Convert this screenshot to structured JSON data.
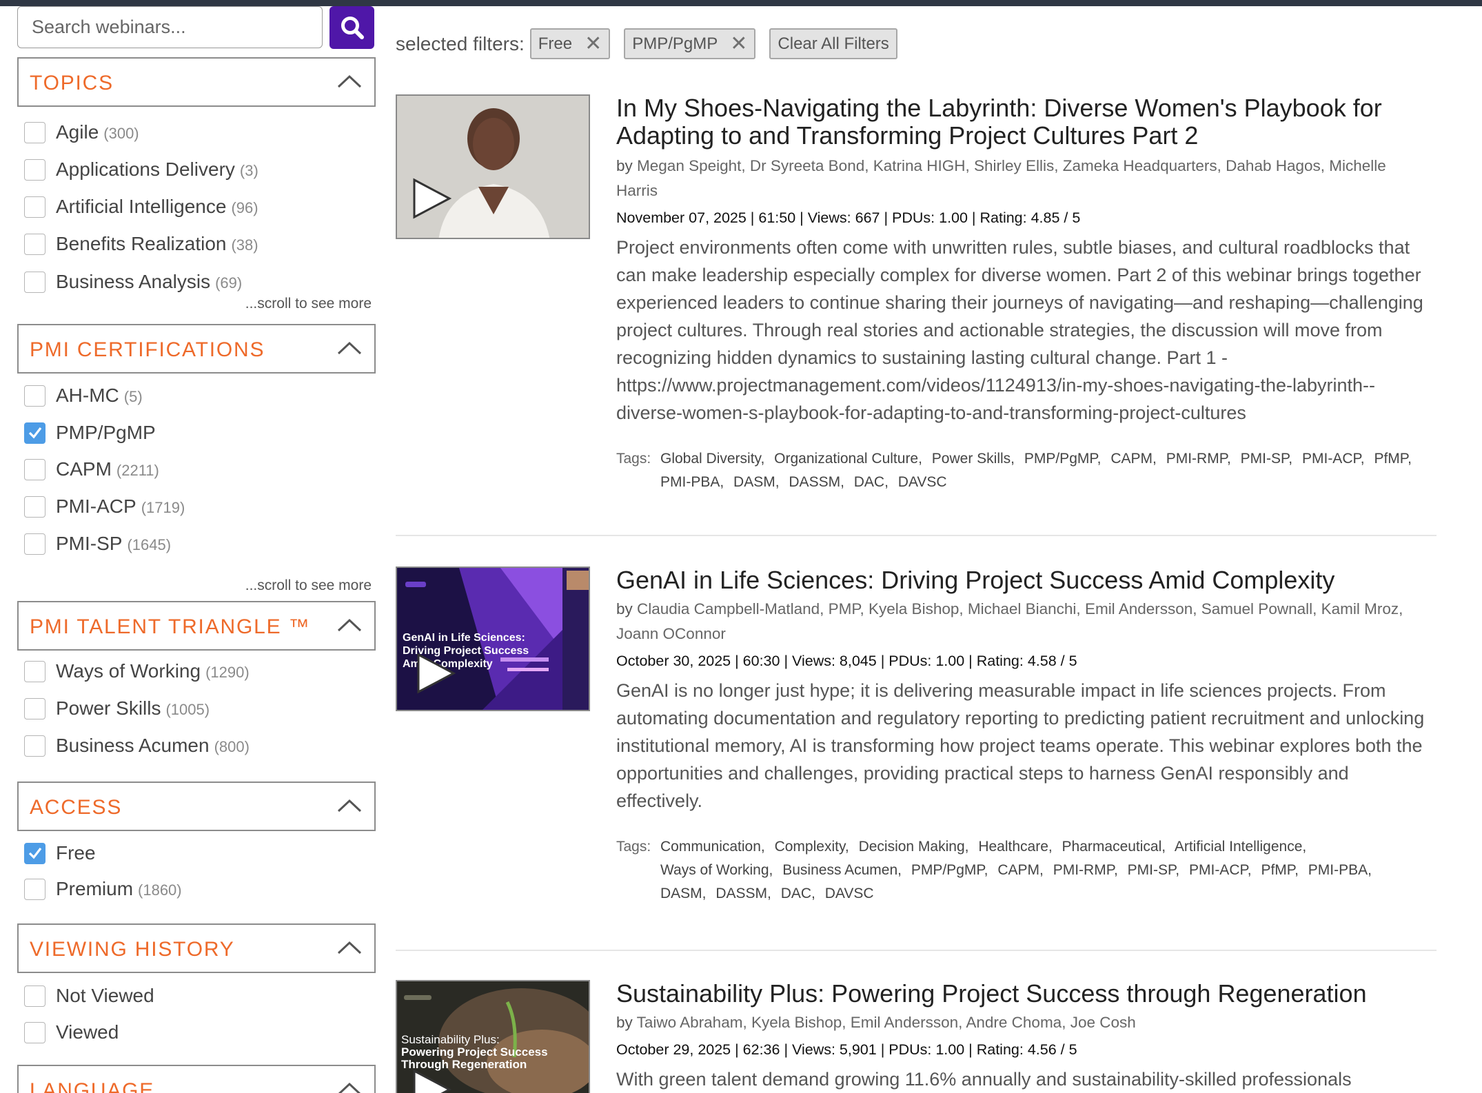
{
  "search": {
    "placeholder": "Search webinars..."
  },
  "facets": {
    "topics": {
      "title": "TOPICS",
      "items": [
        {
          "label": "Agile",
          "count": "(300)",
          "checked": false
        },
        {
          "label": "Applications Delivery",
          "count": "(3)",
          "checked": false
        },
        {
          "label": "Artificial Intelligence",
          "count": "(96)",
          "checked": false
        },
        {
          "label": "Benefits Realization",
          "count": "(38)",
          "checked": false
        },
        {
          "label": "Business Analysis",
          "count": "(69)",
          "checked": false
        }
      ],
      "scroll_text": "...scroll to see more"
    },
    "certifications": {
      "title": "PMI CERTIFICATIONS",
      "items": [
        {
          "label": "AH-MC",
          "count": "(5)",
          "checked": false
        },
        {
          "label": "PMP/PgMP",
          "count": "",
          "checked": true
        },
        {
          "label": "CAPM",
          "count": "(2211)",
          "checked": false
        },
        {
          "label": "PMI-ACP",
          "count": "(1719)",
          "checked": false
        },
        {
          "label": "PMI-SP",
          "count": "(1645)",
          "checked": false
        }
      ],
      "scroll_text": "...scroll to see more"
    },
    "talent": {
      "title": "PMI TALENT TRIANGLE ™",
      "items": [
        {
          "label": "Ways of Working",
          "count": "(1290)",
          "checked": false
        },
        {
          "label": "Power Skills",
          "count": "(1005)",
          "checked": false
        },
        {
          "label": "Business Acumen",
          "count": "(800)",
          "checked": false
        }
      ]
    },
    "access": {
      "title": "ACCESS",
      "items": [
        {
          "label": "Free",
          "count": "",
          "checked": true
        },
        {
          "label": "Premium",
          "count": "(1860)",
          "checked": false
        }
      ]
    },
    "history": {
      "title": "VIEWING HISTORY",
      "items": [
        {
          "label": "Not Viewed",
          "count": "",
          "checked": false
        },
        {
          "label": "Viewed",
          "count": "",
          "checked": false
        }
      ]
    },
    "language": {
      "title": "LANGUAGE"
    }
  },
  "filters": {
    "label": "selected filters:",
    "chips": [
      "Free",
      "PMP/PgMP"
    ],
    "remove_glyph": "✕",
    "clear_label": "Clear All Filters"
  },
  "webinars": [
    {
      "title": "In My Shoes-Navigating the Labyrinth: Diverse Women's Playbook for Adapting to and Transforming Project Cultures Part 2",
      "by": "by",
      "presenters": "Megan Speight, Dr Syreeta Bond, Katrina HIGH, Shirley Ellis, Zameka Headquarters, Dahab Hagos, Michelle Harris",
      "meta": "November 07, 2025 | 61:50 | Views: 667 | PDUs: 1.00 | Rating: 4.85 / 5",
      "description": "Project environments often come with unwritten rules, subtle biases, and cultural roadblocks that can make leadership especially complex for diverse women. Part 2 of this webinar brings together experienced leaders to continue sharing their journeys of navigating—and reshaping—challenging project cultures. Through real stories and actionable strategies, the discussion will move from recognizing hidden dynamics to sustaining lasting cultural change. Part 1 - https://www.projectmanagement.com/videos/1124913/in-my-shoes-navigating-the-labyrinth--diverse-women-s-playbook-for-adapting-to-and-transforming-project-cultures",
      "tags_label": "Tags:",
      "tags": [
        "Global Diversity,",
        "Organizational Culture,",
        "Power Skills,",
        "PMP/PgMP,",
        "CAPM,",
        "PMI-RMP,",
        "PMI-SP,",
        "PMI-ACP,",
        "PfMP,",
        "PMI-PBA,",
        "DASM,",
        "DASSM,",
        "DAC,",
        "DAVSC"
      ],
      "thumb_text": []
    },
    {
      "title": "GenAI in Life Sciences: Driving Project Success Amid Complexity",
      "by": "by",
      "presenters": "Claudia Campbell-Matland, PMP, Kyela Bishop, Michael Bianchi, Emil Andersson, Samuel Pownall, Kamil Mroz, Joann OConnor",
      "meta": "October 30, 2025 | 60:30 | Views: 8,045 | PDUs: 1.00 | Rating: 4.58 / 5",
      "description": "GenAI is no longer just hype; it is delivering measurable impact in life sciences projects. From automating documentation and regulatory reporting to predicting patient recruitment and unlocking institutional memory, AI is transforming how project teams operate. This webinar explores both the opportunities and challenges, providing practical steps to harness GenAI responsibly and effectively.",
      "tags_label": "Tags:",
      "tags": [
        "Communication,",
        "Complexity,",
        "Decision Making,",
        "Healthcare,",
        "Pharmaceutical,",
        "Artificial Intelligence,",
        "Ways of Working,",
        "Business Acumen,",
        "PMP/PgMP,",
        "CAPM,",
        "PMI-RMP,",
        "PMI-SP,",
        "PMI-ACP,",
        "PfMP,",
        "PMI-PBA,",
        "DASM,",
        "DASSM,",
        "DAC,",
        "DAVSC"
      ],
      "thumb_text": [
        "GenAI in Life Sciences:",
        "Driving Project Success",
        "Amid Complexity"
      ]
    },
    {
      "title": "Sustainability Plus: Powering Project Success through Regeneration",
      "by": "by",
      "presenters": "Taiwo Abraham, Kyela Bishop, Emil Andersson, Andre Choma, Joe Cosh",
      "meta": "October 29, 2025 | 62:36 | Views: 5,901 | PDUs: 1.00 | Rating: 4.56 / 5",
      "description": "With green talent demand growing 11.6% annually and sustainability-skilled professionals",
      "thumb_text": [
        "Sustainability Plus:",
        "Powering Project Success",
        "Through Regeneration"
      ]
    }
  ],
  "colors": {
    "accent_orange": "#ee6a2a",
    "search_purple": "#4f17a8",
    "checkbox_blue": "#4d9ce6",
    "top_bar": "#2f3744"
  },
  "icons": {
    "search": "search-icon",
    "chevron": "chevron-up-icon",
    "check": "check-icon",
    "play": "play-icon",
    "remove": "close-icon"
  }
}
